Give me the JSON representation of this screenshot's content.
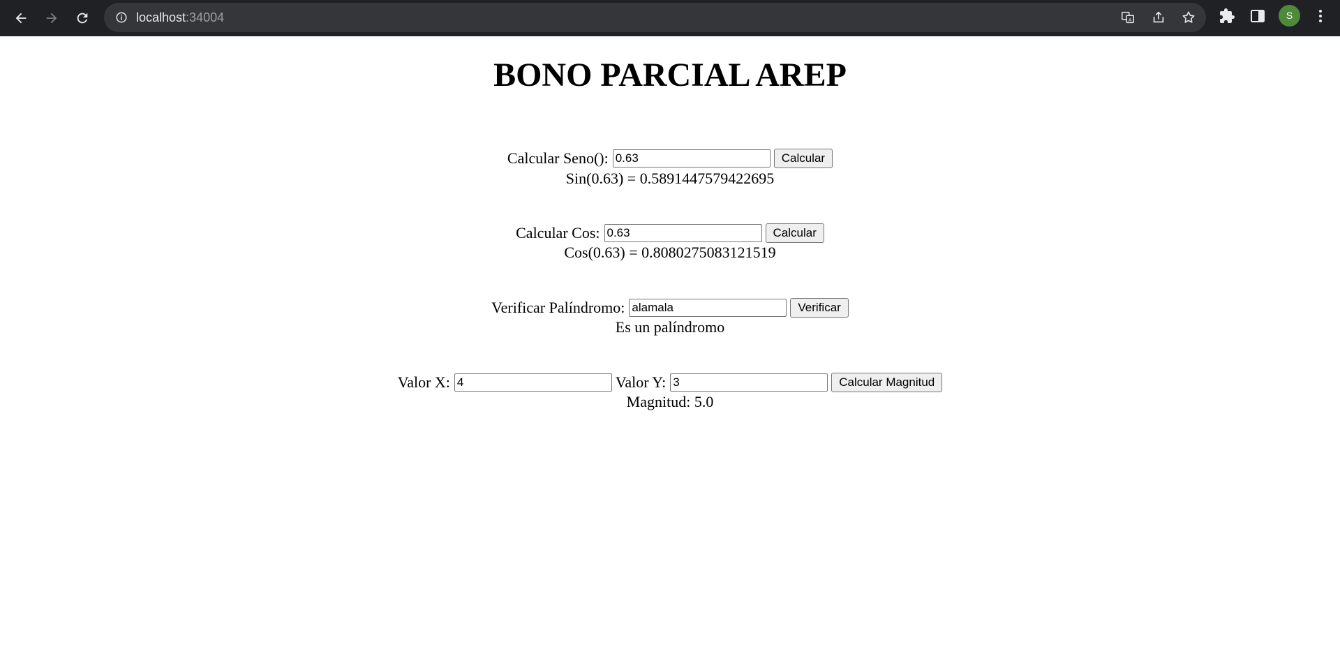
{
  "browser": {
    "url_host": "localhost",
    "url_port": ":34004",
    "avatar_letter": "S"
  },
  "page": {
    "title": "BONO PARCIAL AREP",
    "seno": {
      "label": "Calcular Seno():",
      "value": "0.63",
      "button": "Calcular",
      "result": "Sin(0.63) = 0.5891447579422695"
    },
    "cos": {
      "label": "Calcular Cos:",
      "value": "0.63",
      "button": "Calcular",
      "result": "Cos(0.63) = 0.8080275083121519"
    },
    "palindromo": {
      "label": "Verificar Palíndromo:",
      "value": "alamala",
      "button": "Verificar",
      "result": "Es un palíndromo"
    },
    "magnitud": {
      "label_x": "Valor X:",
      "value_x": "4",
      "label_y": "Valor Y:",
      "value_y": "3",
      "button": "Calcular Magnitud",
      "result": "Magnitud: 5.0"
    }
  }
}
